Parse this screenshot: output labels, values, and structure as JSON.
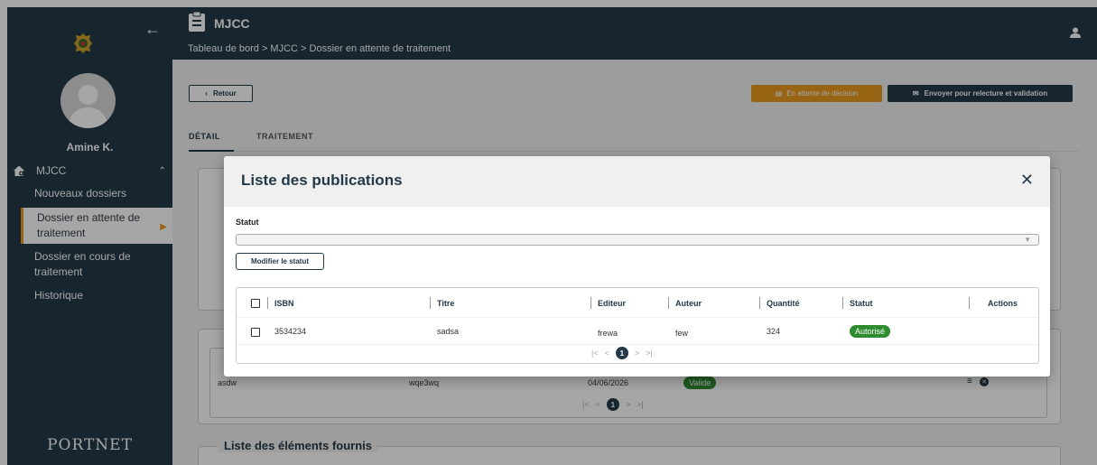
{
  "sidebar": {
    "user_name": "Amine K.",
    "menu_section": "MJCC",
    "items": [
      {
        "label": "Nouveaux dossiers"
      },
      {
        "label": "Dossier en attente de traitement"
      },
      {
        "label": "Dossier en cours de traitement"
      },
      {
        "label": "Historique"
      }
    ],
    "logo_text": "PORTNET"
  },
  "header": {
    "title": "MJCC",
    "breadcrumb": "Tableau de bord > MJCC > Dossier en attente de traitement"
  },
  "actions": {
    "back_label": "Retour",
    "status_label": "En attente de décision",
    "send_label": "Envoyer pour relecture et validation"
  },
  "tabs": [
    {
      "label": "DÉTAIL"
    },
    {
      "label": "TRAITEMENT"
    }
  ],
  "background": {
    "row": {
      "col1": "asdw",
      "col2": "wqe3wq",
      "date": "04/06/2026",
      "status": "Valide"
    },
    "section_title": "Liste des éléments fournis",
    "pager_page": "1"
  },
  "dialog": {
    "title": "Liste des publications",
    "statut_label": "Statut",
    "statut_value": "",
    "modify_button": "Modifier le statut",
    "columns": [
      "ISBN",
      "Titre",
      "Editeur",
      "Auteur",
      "Quantité",
      "Statut",
      "Actions"
    ],
    "rows": [
      {
        "isbn": "3534234",
        "titre": "sadsa",
        "editeur": "frewa",
        "auteur": "few",
        "quantite": "324",
        "statut": "Autorisé"
      }
    ],
    "pager_page": "1"
  },
  "colors": {
    "navy": "#243948",
    "orange": "#e89a1f",
    "green": "#2e8b2e"
  }
}
